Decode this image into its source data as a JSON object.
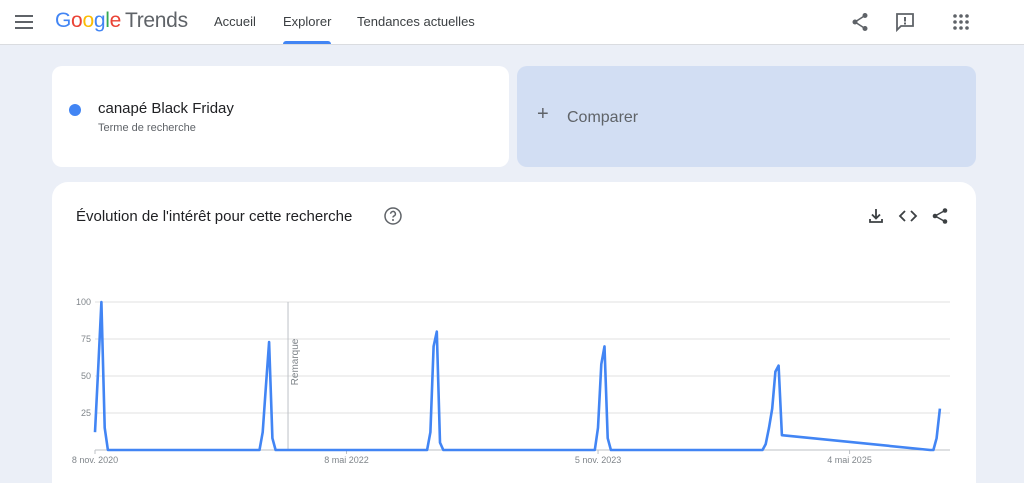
{
  "header": {
    "logo_google": [
      "G",
      "o",
      "o",
      "g",
      "l",
      "e"
    ],
    "logo_trends": "Trends",
    "tabs": [
      {
        "label": "Accueil",
        "active": false
      },
      {
        "label": "Explorer",
        "active": true
      },
      {
        "label": "Tendances actuelles",
        "active": false
      }
    ],
    "icons": [
      "menu-icon",
      "share-icon",
      "feedback-icon",
      "apps-grid-icon"
    ]
  },
  "search_term": {
    "label": "canapé Black Friday",
    "type": "Terme de recherche",
    "color": "#4285f4"
  },
  "compare": {
    "plus": "+",
    "label": "Comparer"
  },
  "chart_panel": {
    "title": "Évolution de l'intérêt pour cette recherche",
    "icons": [
      "help-icon",
      "download-icon",
      "embed-code-icon",
      "share-icon"
    ]
  },
  "chart_data": {
    "type": "line",
    "title": "",
    "xlabel": "",
    "ylabel": "",
    "ylim": [
      0,
      100
    ],
    "y_ticks": [
      "100",
      "75",
      "50",
      "25"
    ],
    "x_tick_labels": [
      "8 nov. 2020",
      "8 mai 2022",
      "5 nov. 2023",
      "4 mai 2025"
    ],
    "annotation": "Remarque",
    "grid": true,
    "series": [
      {
        "color": "#4285f4",
        "x": [
          "2020-11-01",
          "2020-11-15",
          "2020-11-22",
          "2020-11-29",
          "2020-12-06",
          "2020-12-13",
          "2021-10-31",
          "2021-11-07",
          "2021-11-14",
          "2021-11-21",
          "2021-11-28",
          "2021-12-05",
          "2022-10-30",
          "2022-11-06",
          "2022-11-13",
          "2022-11-20",
          "2022-11-27",
          "2022-12-04",
          "2023-10-29",
          "2023-11-05",
          "2023-11-12",
          "2023-11-19",
          "2023-11-26",
          "2023-12-03",
          "2024-10-27",
          "2024-11-03",
          "2024-11-10",
          "2024-11-17",
          "2024-11-24",
          "2024-12-01",
          "2024-12-08",
          "2025-10-26",
          "2025-11-02",
          "2025-11-09",
          "2025-11-16"
        ],
        "values": [
          12,
          55,
          100,
          15,
          0,
          0,
          0,
          12,
          43,
          73,
          8,
          0,
          0,
          12,
          70,
          80,
          5,
          0,
          0,
          15,
          58,
          70,
          8,
          0,
          0,
          4,
          15,
          28,
          53,
          57,
          10,
          0,
          0,
          8,
          28
        ]
      }
    ]
  }
}
